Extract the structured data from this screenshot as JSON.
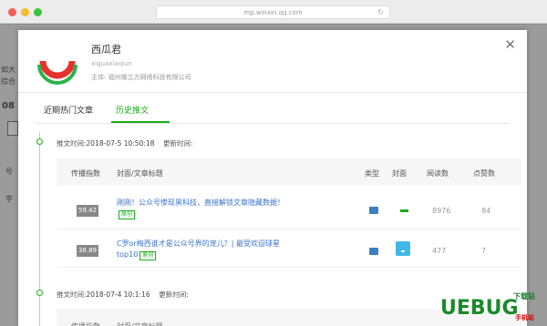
{
  "browser": {
    "url": "mp.weixin.qq.com"
  },
  "background": {
    "fragments": [
      "如大",
      "综合",
      "08",
      "号",
      "字"
    ]
  },
  "account": {
    "name": "西瓜君",
    "id": "xiguaxiaojun",
    "subject": "主体: 福州微立方网络科技有限公司"
  },
  "tabs": [
    {
      "label": "近期热门文章",
      "active": false
    },
    {
      "label": "历史推文",
      "active": true
    }
  ],
  "groups": [
    {
      "push_label": "推文时间:",
      "push_time": "2018-07-5 10:50:18",
      "update_label": "更新时间:",
      "update_time": ""
    },
    {
      "push_label": "推文时间:",
      "push_time": "2018-07-4 10:1:16",
      "update_label": "更新时间:",
      "update_time": ""
    }
  ],
  "columns": {
    "score": "传播指数",
    "title": "封面/文章标题",
    "type": "类型",
    "cover": "封面",
    "reads": "阅读数",
    "likes": "点赞数"
  },
  "rows": [
    {
      "score": "59.42",
      "title": "刚刚！公众号惨现黑科技，直接解锁文章隐藏数据！",
      "badge": "原创",
      "reads": "8976",
      "likes": "84"
    },
    {
      "score": "38.89",
      "title": "C罗or梅西谁才是公众号界的宠儿？| 最受欢迎球星top10",
      "badge": "原创",
      "reads": "477",
      "likes": "7"
    }
  ],
  "watermark": {
    "brand": "UEBUG",
    "top": "下载站",
    "sub": "手机站"
  },
  "colors": {
    "accent": "#1aad19",
    "link": "#3b73c8",
    "logo_red": "#e6322e",
    "logo_green": "#2db24b"
  }
}
